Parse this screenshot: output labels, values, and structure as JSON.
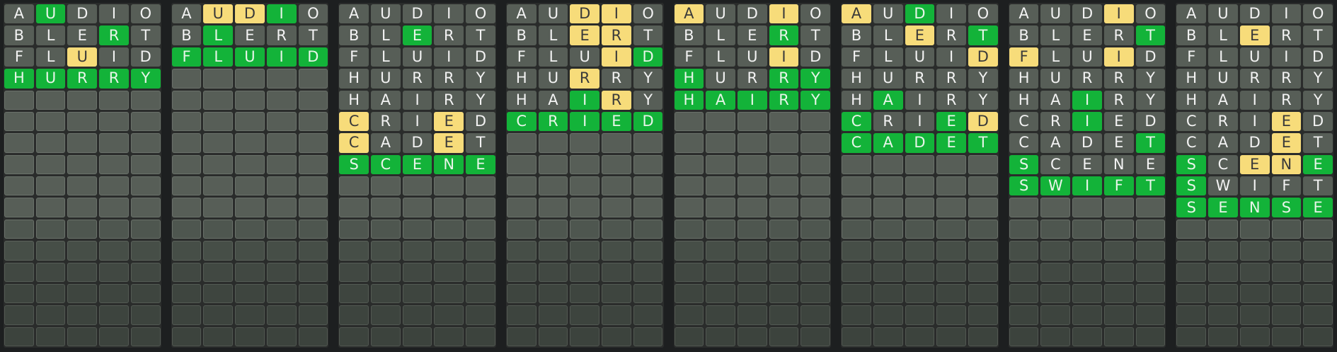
{
  "rows_per_board": 16,
  "colors": {
    "correct": "#13b339",
    "present": "#f7dc7a",
    "absent": "#575e57",
    "empty": "#575e57"
  },
  "boards": [
    {
      "guesses": [
        {
          "word": "AUDIO",
          "states": [
            "a",
            "c",
            "a",
            "a",
            "a"
          ]
        },
        {
          "word": "BLERT",
          "states": [
            "a",
            "a",
            "a",
            "c",
            "a"
          ]
        },
        {
          "word": "FLUID",
          "states": [
            "a",
            "a",
            "p",
            "a",
            "a"
          ]
        },
        {
          "word": "HURRY",
          "states": [
            "c",
            "c",
            "c",
            "c",
            "c"
          ]
        }
      ]
    },
    {
      "guesses": [
        {
          "word": "AUDIO",
          "states": [
            "a",
            "p",
            "p",
            "c",
            "a"
          ]
        },
        {
          "word": "BLERT",
          "states": [
            "a",
            "c",
            "a",
            "a",
            "a"
          ]
        },
        {
          "word": "FLUID",
          "states": [
            "c",
            "c",
            "c",
            "c",
            "c"
          ]
        }
      ]
    },
    {
      "guesses": [
        {
          "word": "AUDIO",
          "states": [
            "a",
            "a",
            "a",
            "a",
            "a"
          ]
        },
        {
          "word": "BLERT",
          "states": [
            "a",
            "a",
            "c",
            "a",
            "a"
          ]
        },
        {
          "word": "FLUID",
          "states": [
            "a",
            "a",
            "a",
            "a",
            "a"
          ]
        },
        {
          "word": "HURRY",
          "states": [
            "a",
            "a",
            "a",
            "a",
            "a"
          ]
        },
        {
          "word": "HAIRY",
          "states": [
            "a",
            "a",
            "a",
            "a",
            "a"
          ]
        },
        {
          "word": "CRIED",
          "states": [
            "p",
            "a",
            "a",
            "p",
            "a"
          ]
        },
        {
          "word": "CADET",
          "states": [
            "p",
            "a",
            "a",
            "p",
            "a"
          ]
        },
        {
          "word": "SCENE",
          "states": [
            "c",
            "c",
            "c",
            "c",
            "c"
          ]
        }
      ]
    },
    {
      "guesses": [
        {
          "word": "AUDIO",
          "states": [
            "a",
            "a",
            "p",
            "p",
            "a"
          ]
        },
        {
          "word": "BLERT",
          "states": [
            "a",
            "a",
            "p",
            "p",
            "a"
          ]
        },
        {
          "word": "FLUID",
          "states": [
            "a",
            "a",
            "a",
            "p",
            "c"
          ]
        },
        {
          "word": "HURRY",
          "states": [
            "a",
            "a",
            "p",
            "a",
            "a"
          ]
        },
        {
          "word": "HAIRY",
          "states": [
            "a",
            "a",
            "c",
            "p",
            "a"
          ]
        },
        {
          "word": "CRIED",
          "states": [
            "c",
            "c",
            "c",
            "c",
            "c"
          ]
        }
      ]
    },
    {
      "guesses": [
        {
          "word": "AUDIO",
          "states": [
            "p",
            "a",
            "a",
            "p",
            "a"
          ]
        },
        {
          "word": "BLERT",
          "states": [
            "a",
            "a",
            "a",
            "c",
            "a"
          ]
        },
        {
          "word": "FLUID",
          "states": [
            "a",
            "a",
            "a",
            "p",
            "a"
          ]
        },
        {
          "word": "HURRY",
          "states": [
            "c",
            "a",
            "a",
            "c",
            "c"
          ]
        },
        {
          "word": "HAIRY",
          "states": [
            "c",
            "c",
            "c",
            "c",
            "c"
          ]
        }
      ]
    },
    {
      "guesses": [
        {
          "word": "AUDIO",
          "states": [
            "p",
            "a",
            "c",
            "a",
            "a"
          ]
        },
        {
          "word": "BLERT",
          "states": [
            "a",
            "a",
            "p",
            "a",
            "c"
          ]
        },
        {
          "word": "FLUID",
          "states": [
            "a",
            "a",
            "a",
            "a",
            "p"
          ]
        },
        {
          "word": "HURRY",
          "states": [
            "a",
            "a",
            "a",
            "a",
            "a"
          ]
        },
        {
          "word": "HAIRY",
          "states": [
            "a",
            "c",
            "a",
            "a",
            "a"
          ]
        },
        {
          "word": "CRIED",
          "states": [
            "c",
            "a",
            "a",
            "c",
            "p"
          ]
        },
        {
          "word": "CADET",
          "states": [
            "c",
            "c",
            "c",
            "c",
            "c"
          ]
        }
      ]
    },
    {
      "guesses": [
        {
          "word": "AUDIO",
          "states": [
            "a",
            "a",
            "a",
            "p",
            "a"
          ]
        },
        {
          "word": "BLERT",
          "states": [
            "a",
            "a",
            "a",
            "a",
            "c"
          ]
        },
        {
          "word": "FLUID",
          "states": [
            "p",
            "a",
            "a",
            "p",
            "a"
          ]
        },
        {
          "word": "HURRY",
          "states": [
            "a",
            "a",
            "a",
            "a",
            "a"
          ]
        },
        {
          "word": "HAIRY",
          "states": [
            "a",
            "a",
            "c",
            "a",
            "a"
          ]
        },
        {
          "word": "CRIED",
          "states": [
            "a",
            "a",
            "c",
            "a",
            "a"
          ]
        },
        {
          "word": "CADET",
          "states": [
            "a",
            "a",
            "a",
            "a",
            "c"
          ]
        },
        {
          "word": "SCENE",
          "states": [
            "c",
            "a",
            "a",
            "a",
            "a"
          ]
        },
        {
          "word": "SWIFT",
          "states": [
            "c",
            "c",
            "c",
            "c",
            "c"
          ]
        }
      ]
    },
    {
      "guesses": [
        {
          "word": "AUDIO",
          "states": [
            "a",
            "a",
            "a",
            "a",
            "a"
          ]
        },
        {
          "word": "BLERT",
          "states": [
            "a",
            "a",
            "p",
            "a",
            "a"
          ]
        },
        {
          "word": "FLUID",
          "states": [
            "a",
            "a",
            "a",
            "a",
            "a"
          ]
        },
        {
          "word": "HURRY",
          "states": [
            "a",
            "a",
            "a",
            "a",
            "a"
          ]
        },
        {
          "word": "HAIRY",
          "states": [
            "a",
            "a",
            "a",
            "a",
            "a"
          ]
        },
        {
          "word": "CRIED",
          "states": [
            "a",
            "a",
            "a",
            "p",
            "a"
          ]
        },
        {
          "word": "CADET",
          "states": [
            "a",
            "a",
            "a",
            "p",
            "a"
          ]
        },
        {
          "word": "SCENE",
          "states": [
            "c",
            "a",
            "p",
            "p",
            "c"
          ]
        },
        {
          "word": "SWIFT",
          "states": [
            "c",
            "a",
            "a",
            "a",
            "a"
          ]
        },
        {
          "word": "SENSE",
          "states": [
            "c",
            "c",
            "c",
            "c",
            "c"
          ]
        }
      ]
    }
  ]
}
